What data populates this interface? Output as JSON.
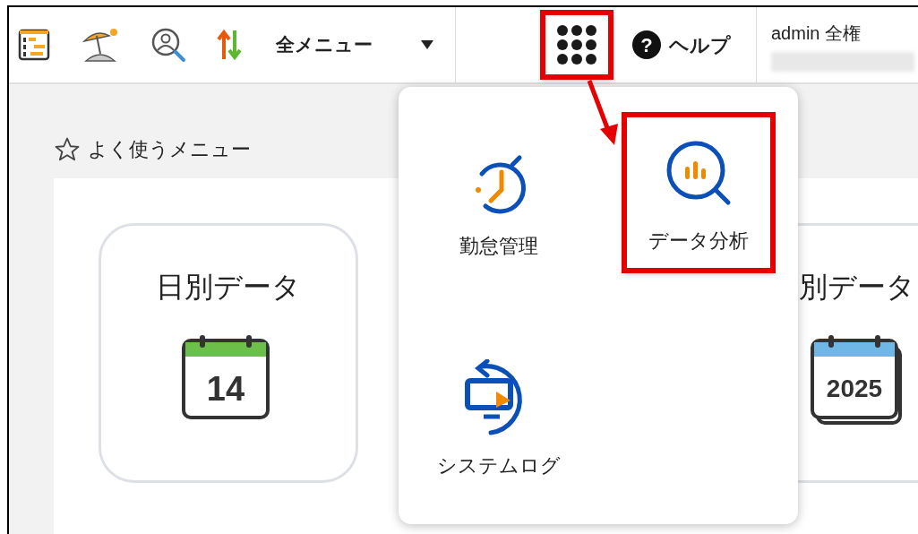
{
  "header": {
    "all_menu": "全メニュー",
    "help": "ヘルプ",
    "help_icon": "?",
    "user": "admin 全権",
    "apps_button": {
      "highlighted": true
    }
  },
  "favorites": {
    "title": "よく使うメニュー",
    "tiles": [
      {
        "label": "日別データ",
        "kind": "day",
        "date": "14"
      },
      {
        "label": "別データ",
        "kind": "year",
        "date": "2025"
      }
    ]
  },
  "app_menu": {
    "items": [
      {
        "label": "勤怠管理",
        "kind": "clock",
        "highlighted": false
      },
      {
        "label": "データ分析",
        "kind": "analysis",
        "highlighted": true
      },
      {
        "label": "システムログ",
        "kind": "log",
        "highlighted": false
      }
    ]
  }
}
